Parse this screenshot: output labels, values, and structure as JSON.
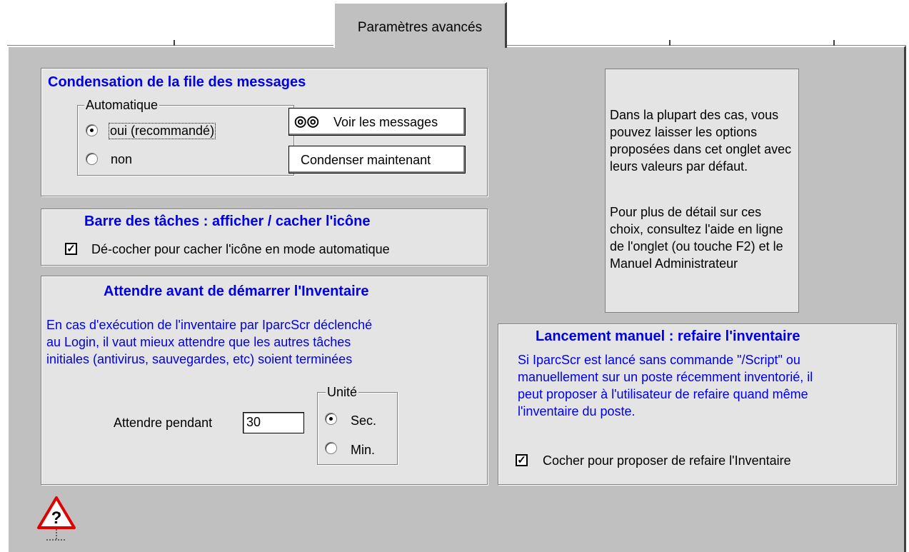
{
  "tab": {
    "label": "Paramètres avancés"
  },
  "condensation": {
    "title": "Condensation de la file des messages",
    "legend": "Automatique",
    "options": [
      "oui (recommandé)",
      "non"
    ],
    "selected": "oui (recommandé)",
    "view_button": "Voir les messages",
    "condense_button": "Condenser maintenant"
  },
  "taskbar": {
    "title": "Barre des tâches : afficher / cacher l'icône",
    "checkbox_label": "Dé-cocher pour cacher l'icône en mode automatique",
    "checked": true
  },
  "wait": {
    "title": "Attendre avant de démarrer l'Inventaire",
    "description_lines": [
      "En cas d'exécution de l'inventaire par IparcScr déclenché",
      "au Login, il vaut mieux attendre que les autres tâches",
      "initiales (antivirus, sauvegardes, etc) soient terminées"
    ],
    "field_label": "Attendre pendant",
    "field_value": "30",
    "unit_legend": "Unité",
    "unit_options": [
      "Sec.",
      "Min."
    ],
    "unit_selected": "Sec."
  },
  "info": {
    "paragraph1": [
      "Dans la plupart des cas, vous",
      "pouvez laisser les options",
      "proposées dans cet onglet avec",
      "leurs valeurs par défaut."
    ],
    "paragraph2": [
      "Pour plus de détail sur ces",
      "choix, consultez l'aide en ligne",
      "de l'onglet (ou touche F2) et le",
      "Manuel Administrateur"
    ]
  },
  "manual": {
    "title": "Lancement manuel : refaire l'inventaire",
    "description_lines": [
      "Si IparcScr est lancé sans commande \"/Script\" ou",
      "manuellement sur un poste récemment inventorié, il",
      "peut proposer à l'utilisateur de refaire quand même",
      "l'inventaire du poste."
    ],
    "checkbox_label": "Cocher pour proposer de refaire l'Inventaire",
    "checked": true
  },
  "icons": {
    "view_button_icon": "binoculars-icon",
    "help_icon": "warning-help-icon"
  }
}
